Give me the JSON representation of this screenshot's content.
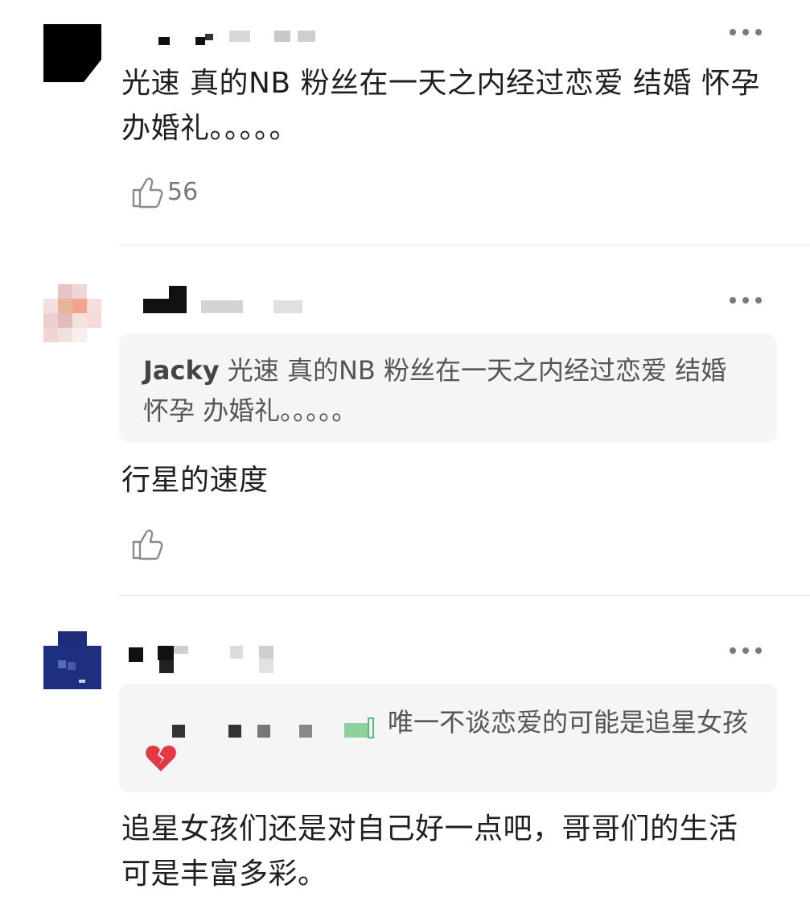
{
  "comments": [
    {
      "author": "",
      "meta": "",
      "text": "光速 真的NB 粉丝在一天之内经过恋爱 结婚 怀孕 办婚礼。。。。。",
      "likes": "56",
      "like_icon": "thumbs-up-icon",
      "more_icon": "more-dots-icon"
    },
    {
      "author": "",
      "meta": "",
      "quote": {
        "user": "Jacky",
        "text": " 光速 真的NB 粉丝在一天之内经过恋爱 结婚 怀孕 办婚礼。。。。。"
      },
      "text": "行星的速度",
      "likes": "",
      "like_icon": "thumbs-up-icon",
      "more_icon": "more-dots-icon"
    },
    {
      "author": "",
      "meta": "",
      "quote": {
        "user": "",
        "text": "唯一不谈恋爱的可能是追星女孩",
        "emoji": "broken-heart-icon"
      },
      "text": "追星女孩们还是对自己好一点吧，哥哥们的生活可是丰富多彩。",
      "more_icon": "more-dots-icon"
    }
  ]
}
